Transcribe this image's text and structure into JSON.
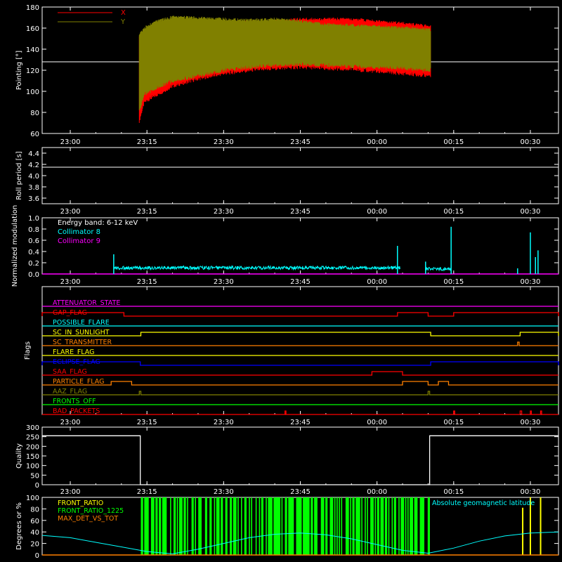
{
  "chart_data": [
    {
      "type": "line",
      "panel": "pointing",
      "ylabel": "Pointing [°]",
      "ylim": [
        60,
        180
      ],
      "yticks": [
        60,
        80,
        100,
        120,
        140,
        160,
        180
      ],
      "xlim_minutes": [
        -5.5,
        35.5
      ],
      "xticks": [
        "23:00",
        "23:15",
        "23:30",
        "23:45",
        "00:00",
        "00:15",
        "00:30"
      ],
      "xtick_minutes": [
        0,
        15,
        30,
        45,
        60,
        75,
        90
      ],
      "baseline": 128,
      "series": [
        {
          "name": "X",
          "color": "#ff0000",
          "t": [
            13.5,
            14.5,
            17,
            20,
            25,
            30,
            35,
            40,
            45,
            50,
            55,
            60,
            65,
            70.5
          ],
          "min": [
            70,
            88,
            95,
            103,
            110,
            115,
            118,
            120,
            121,
            120,
            119,
            117,
            115,
            113
          ],
          "max": [
            152,
            160,
            166,
            168,
            168,
            167,
            167,
            168,
            170,
            170,
            170,
            168,
            166,
            163
          ]
        },
        {
          "name": "Y",
          "color": "#808000",
          "t": [
            13.5,
            14.5,
            17,
            20,
            25,
            30,
            35,
            40,
            45,
            50,
            55,
            60,
            65,
            70.5
          ],
          "min": [
            80,
            95,
            102,
            108,
            113,
            118,
            121,
            123,
            124,
            123,
            122,
            121,
            120,
            118
          ],
          "max": [
            155,
            162,
            168,
            172,
            171,
            170,
            169,
            170,
            168,
            165,
            164,
            163,
            162,
            160
          ]
        }
      ]
    },
    {
      "type": "line",
      "panel": "roll_period",
      "ylabel": "Roll period [s]",
      "ylim": [
        3.5,
        4.5
      ],
      "yticks": [
        3.6,
        3.8,
        4.0,
        4.2,
        4.4
      ],
      "value": 4.15,
      "xticks": [
        "23:00",
        "23:15",
        "23:30",
        "23:45",
        "00:00",
        "00:15",
        "00:30"
      ]
    },
    {
      "type": "line",
      "panel": "modulation",
      "ylabel": "Normalized modulation",
      "ylim": [
        0,
        1
      ],
      "yticks": [
        "0.0",
        "0.2",
        "0.4",
        "0.6",
        "0.8",
        "1.0"
      ],
      "annotation": "Energy band: 6-12 keV",
      "series": [
        {
          "name": "Collimator 8",
          "color": "#00ffff",
          "segments": [
            [
              8.5,
              64.5,
              0.11
            ],
            [
              69.5,
              74.5,
              0.09
            ]
          ],
          "spikes": [
            [
              8.5,
              0.35
            ],
            [
              64,
              0.5
            ],
            [
              69.5,
              0.22
            ],
            [
              74.5,
              0.84
            ],
            [
              87.5,
              0.1
            ],
            [
              90,
              0.74
            ],
            [
              91.5,
              0.42
            ],
            [
              91,
              0.3
            ]
          ]
        },
        {
          "name": "Collimator 9",
          "color": "#ff00ff",
          "baseline": 0.0
        }
      ],
      "xticks": [
        "23:00",
        "23:15",
        "23:30",
        "23:45",
        "00:00",
        "00:15",
        "00:30"
      ]
    },
    {
      "type": "line",
      "panel": "flags",
      "ylabel": "Flags",
      "flags": [
        {
          "name": "ATTENUATOR_STATE",
          "color": "#ff00ff",
          "on": []
        },
        {
          "name": "GAP_FLAG",
          "color": "#ff0000",
          "on": [
            [
              -5.5,
              10.5
            ],
            [
              64,
              70
            ],
            [
              75,
              95.5
            ]
          ]
        },
        {
          "name": "POSSIBLE_FLARE",
          "color": "#00ffff",
          "on": []
        },
        {
          "name": "SC_IN_SUNLIGHT",
          "color": "#ffff00",
          "on": [
            [
              13.8,
              70.5
            ],
            [
              88,
              95.5
            ]
          ]
        },
        {
          "name": "SC_TRANSMITTER",
          "color": "#ff8000",
          "on": [
            [
              87.5,
              87.8
            ]
          ]
        },
        {
          "name": "FLARE_FLAG",
          "color": "#ffff00",
          "on": []
        },
        {
          "name": "ECLIPSE_FLAG",
          "color": "#0000ff",
          "on": [
            [
              -5.5,
              13.7
            ],
            [
              70.5,
              95.5
            ]
          ]
        },
        {
          "name": "SAA_FLAG",
          "color": "#ff0000",
          "on": [
            [
              59,
              65
            ]
          ]
        },
        {
          "name": "PARTICLE_FLAG",
          "color": "#ff8000",
          "on": [
            [
              8,
              12
            ],
            [
              65,
              70
            ],
            [
              72,
              74
            ]
          ]
        },
        {
          "name": "AAZ_FLAG",
          "color": "#808000",
          "on": [
            [
              13.5,
              13.8
            ],
            [
              70,
              70.3
            ]
          ]
        },
        {
          "name": "FRONTS_OFF",
          "color": "#00ff00",
          "on": []
        },
        {
          "name": "BAD_PACKETS",
          "color": "#ff0000",
          "on": [
            [
              42,
              42.2
            ],
            [
              75,
              75.2
            ],
            [
              88,
              88.3
            ],
            [
              90,
              90.2
            ],
            [
              92,
              92.2
            ]
          ]
        }
      ],
      "xticks": [
        "23:00",
        "23:15",
        "23:30",
        "23:45",
        "00:00",
        "00:15",
        "00:30"
      ]
    },
    {
      "type": "line",
      "panel": "quality",
      "ylabel": "Quality",
      "ylim": [
        0,
        300
      ],
      "yticks": [
        0,
        50,
        100,
        150,
        200,
        250,
        300
      ],
      "segments": [
        [
          -5.5,
          13.7,
          255
        ],
        [
          13.7,
          70.3,
          0
        ],
        [
          70.3,
          95.5,
          255
        ]
      ],
      "xticks": [
        "23:00",
        "23:15",
        "23:30",
        "23:45",
        "00:00",
        "00:15",
        "00:30"
      ]
    },
    {
      "type": "line",
      "panel": "ratios",
      "ylabel": "Degrees or %",
      "ylim": [
        0,
        100
      ],
      "yticks": [
        0,
        20,
        40,
        60,
        80,
        100
      ],
      "series": [
        {
          "name": "FRONT_RATIO",
          "color": "#ffff00",
          "bars": [
            [
              88.5,
              82
            ],
            [
              90,
              100
            ],
            [
              92,
              100
            ]
          ]
        },
        {
          "name": "FRONT_RATIO_1225",
          "color": "#00ff00",
          "band": [
            13.7,
            70.3
          ]
        },
        {
          "name": "MAX_DET_VS_TOT",
          "color": "#ff8000",
          "baseline": 0
        }
      ],
      "latitude": {
        "name": "Absolute geomagnetic latitude",
        "color": "#00ffff",
        "t": [
          -5.5,
          0,
          5,
          10,
          15,
          20,
          25,
          30,
          35,
          40,
          45,
          50,
          55,
          60,
          65,
          70,
          75,
          80,
          85,
          90,
          95.5
        ],
        "v": [
          34,
          30,
          22,
          14,
          6,
          2,
          10,
          20,
          30,
          36,
          38,
          35,
          28,
          18,
          8,
          3,
          12,
          24,
          33,
          38,
          40
        ]
      },
      "xticks": [
        "23:00",
        "23:15",
        "23:30",
        "23:45",
        "00:00",
        "00:15",
        "00:30"
      ]
    }
  ]
}
